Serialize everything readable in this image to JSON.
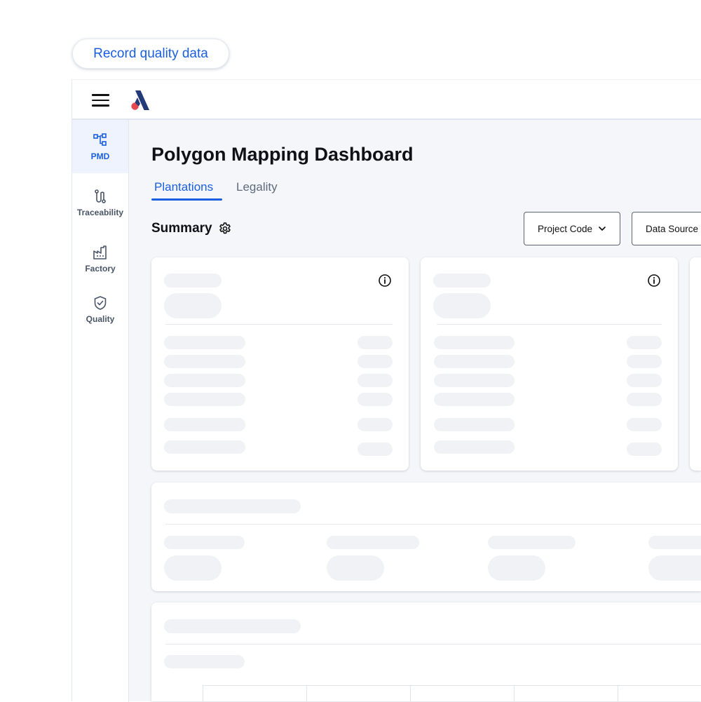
{
  "record_button": {
    "label": "Record quality data"
  },
  "sidebar": {
    "items": [
      {
        "label": "PMD",
        "icon": "hierarchy-icon",
        "active": true
      },
      {
        "label": "Traceability",
        "icon": "route-icon",
        "active": false
      },
      {
        "label": "Factory",
        "icon": "factory-icon",
        "active": false
      },
      {
        "label": "Quality",
        "icon": "shield-check-icon",
        "active": false
      }
    ]
  },
  "main": {
    "title": "Polygon Mapping Dashboard",
    "tabs": [
      {
        "label": "Plantations",
        "active": true
      },
      {
        "label": "Legality",
        "active": false
      }
    ],
    "summary": {
      "label": "Summary"
    },
    "filters": [
      {
        "label": "Project Code"
      },
      {
        "label": "Data Source"
      }
    ]
  },
  "colors": {
    "accent": "#1a5fe0",
    "logo_navy": "#233a7a",
    "logo_red": "#e5484d",
    "skeleton": "#f0f2f5"
  }
}
